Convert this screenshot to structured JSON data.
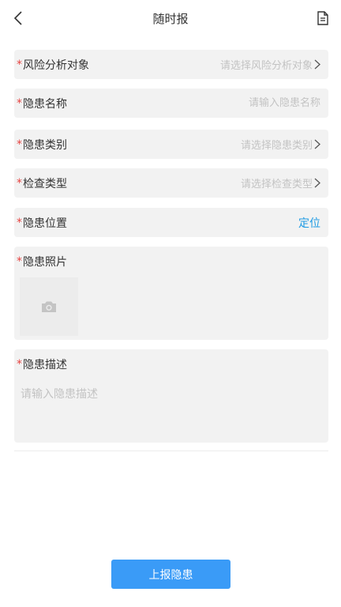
{
  "header": {
    "title": "随时报"
  },
  "form": {
    "required_mark": "*",
    "risk_object": {
      "label": "风险分析对象",
      "placeholder": "请选择风险分析对象"
    },
    "hazard_name": {
      "label": "隐患名称",
      "placeholder": "请输入隐患名称"
    },
    "hazard_category": {
      "label": "隐患类别",
      "placeholder": "请选择隐患类别"
    },
    "check_type": {
      "label": "检查类型",
      "placeholder": "请选择检查类型"
    },
    "hazard_location": {
      "label": "隐患位置",
      "action": "定位"
    },
    "hazard_photo": {
      "label": "隐患照片"
    },
    "hazard_description": {
      "label": "隐患描述",
      "placeholder": "请输入隐患描述"
    }
  },
  "footer": {
    "submit_label": "上报隐患"
  },
  "colors": {
    "accent": "#3a9bf7",
    "link": "#1e9be4",
    "required": "#e64340",
    "field_bg": "#f2f2f2",
    "placeholder": "#c3c3c3"
  }
}
